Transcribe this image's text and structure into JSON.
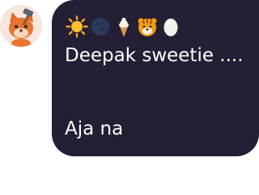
{
  "contact": {
    "avatar_icon": "fox-with-hammer-avatar-icon"
  },
  "message": {
    "emojis": [
      "sun-emoji",
      "new-moon-emoji",
      "ice-cream-emoji",
      "tiger-face-emoji",
      "egg-emoji"
    ],
    "line1": "Deepak sweetie ....",
    "line2": "Aja na"
  },
  "colors": {
    "bubble_background": "#251f35",
    "message_text": "#ffffff",
    "avatar_background": "#f7e6dd"
  }
}
